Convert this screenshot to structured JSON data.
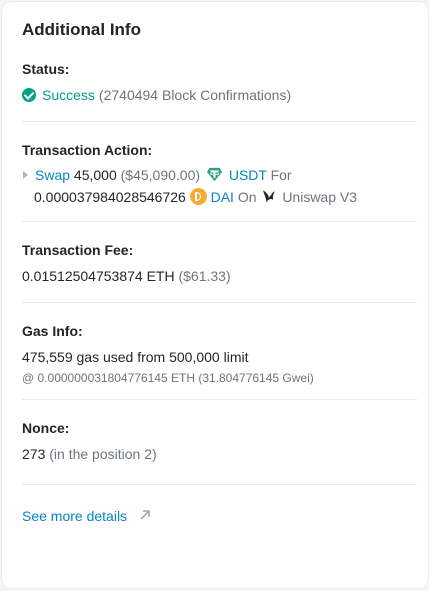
{
  "title": "Additional Info",
  "status": {
    "label": "Status:",
    "value": "Success",
    "confirmations": "(2740494 Block Confirmations)"
  },
  "action": {
    "label": "Transaction Action:",
    "verb": "Swap",
    "amount": "45,000",
    "usd": "($45,090.00)",
    "from_token": "USDT",
    "for": "For",
    "to_amount": "0.000037984028546726",
    "to_token": "DAI",
    "on": "On",
    "protocol": "Uniswap V3"
  },
  "fee": {
    "label": "Transaction Fee:",
    "value": "0.01512504753874 ETH",
    "usd": "($61.33)"
  },
  "gas": {
    "label": "Gas Info:",
    "usage": "475,559 gas used from 500,000 limit",
    "price": "@ 0.000000031804776145 ETH (31.804776145 Gwei)"
  },
  "nonce": {
    "label": "Nonce:",
    "value": "273",
    "position": "(in the position 2)"
  },
  "more_link": "See more details",
  "colors": {
    "link": "#0784c3",
    "success": "#00a186",
    "muted": "#6c757d",
    "usdt": "#26a17b",
    "dai": "#f5ac37"
  },
  "icons": [
    "check-circle-icon",
    "caret-right-icon",
    "usdt-token-icon",
    "dai-token-icon",
    "uniswap-icon",
    "arrow-up-right-icon"
  ]
}
